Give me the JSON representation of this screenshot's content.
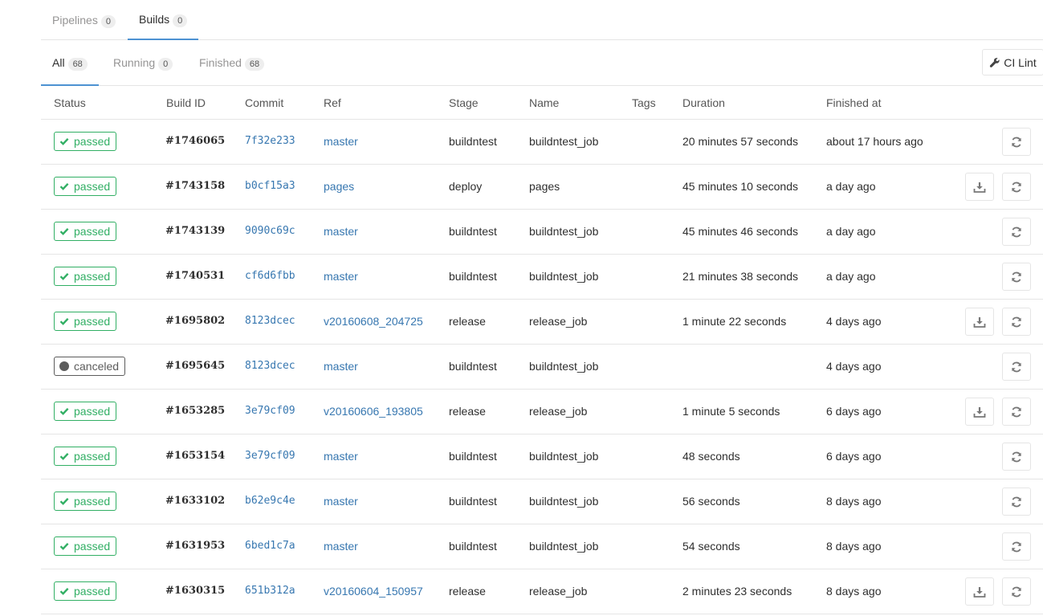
{
  "top_tabs": [
    {
      "label": "Pipelines",
      "count": "0"
    },
    {
      "label": "Builds",
      "count": "0"
    }
  ],
  "sub_tabs": [
    {
      "label": "All",
      "count": "68"
    },
    {
      "label": "Running",
      "count": "0"
    },
    {
      "label": "Finished",
      "count": "68"
    }
  ],
  "ci_lint_label": "CI Lint",
  "columns": [
    "Status",
    "Build ID",
    "Commit",
    "Ref",
    "Stage",
    "Name",
    "Tags",
    "Duration",
    "Finished at"
  ],
  "rows": [
    {
      "status": "passed",
      "id": "#1746065",
      "commit": "7f32e233",
      "ref": "master",
      "stage": "buildntest",
      "name": "buildntest_job",
      "duration": "20 minutes 57 seconds",
      "finished": "about 17 hours ago",
      "download": false
    },
    {
      "status": "passed",
      "id": "#1743158",
      "commit": "b0cf15a3",
      "ref": "pages",
      "stage": "deploy",
      "name": "pages",
      "duration": "45 minutes 10 seconds",
      "finished": "a day ago",
      "download": true
    },
    {
      "status": "passed",
      "id": "#1743139",
      "commit": "9090c69c",
      "ref": "master",
      "stage": "buildntest",
      "name": "buildntest_job",
      "duration": "45 minutes 46 seconds",
      "finished": "a day ago",
      "download": false
    },
    {
      "status": "passed",
      "id": "#1740531",
      "commit": "cf6d6fbb",
      "ref": "master",
      "stage": "buildntest",
      "name": "buildntest_job",
      "duration": "21 minutes 38 seconds",
      "finished": "a day ago",
      "download": false
    },
    {
      "status": "passed",
      "id": "#1695802",
      "commit": "8123dcec",
      "ref": "v20160608_204725",
      "stage": "release",
      "name": "release_job",
      "duration": "1 minute 22 seconds",
      "finished": "4 days ago",
      "download": true
    },
    {
      "status": "canceled",
      "id": "#1695645",
      "commit": "8123dcec",
      "ref": "master",
      "stage": "buildntest",
      "name": "buildntest_job",
      "duration": "",
      "finished": "4 days ago",
      "download": false
    },
    {
      "status": "passed",
      "id": "#1653285",
      "commit": "3e79cf09",
      "ref": "v20160606_193805",
      "stage": "release",
      "name": "release_job",
      "duration": "1 minute 5 seconds",
      "finished": "6 days ago",
      "download": true
    },
    {
      "status": "passed",
      "id": "#1653154",
      "commit": "3e79cf09",
      "ref": "master",
      "stage": "buildntest",
      "name": "buildntest_job",
      "duration": "48 seconds",
      "finished": "6 days ago",
      "download": false
    },
    {
      "status": "passed",
      "id": "#1633102",
      "commit": "b62e9c4e",
      "ref": "master",
      "stage": "buildntest",
      "name": "buildntest_job",
      "duration": "56 seconds",
      "finished": "8 days ago",
      "download": false
    },
    {
      "status": "passed",
      "id": "#1631953",
      "commit": "6bed1c7a",
      "ref": "master",
      "stage": "buildntest",
      "name": "buildntest_job",
      "duration": "54 seconds",
      "finished": "8 days ago",
      "download": false
    },
    {
      "status": "passed",
      "id": "#1630315",
      "commit": "651b312a",
      "ref": "v20160604_150957",
      "stage": "release",
      "name": "release_job",
      "duration": "2 minutes 23 seconds",
      "finished": "8 days ago",
      "download": true
    }
  ],
  "colors": {
    "passed": "#31af64",
    "canceled": "#5c5c5c",
    "link": "#3777b0",
    "active_tab": "#4d92d2"
  }
}
